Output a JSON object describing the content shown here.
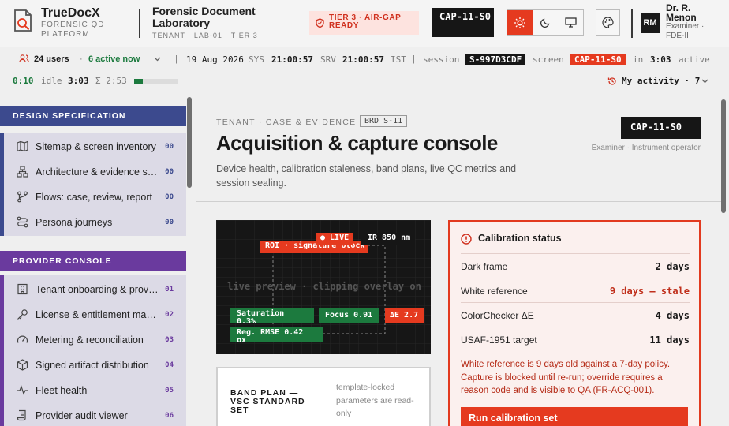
{
  "app": {
    "name": "TrueDocX",
    "subtitle": "FORENSIC QD PLATFORM"
  },
  "lab": {
    "title": "Forensic Document Laboratory",
    "subtitle": "TENANT · LAB-01 · TIER 3"
  },
  "tier_badge": "TIER 3 · AIR-GAP READY",
  "screen_badge": "CAP-11-S0",
  "user": {
    "initials": "RM",
    "name": "Dr. R. Menon",
    "role": "Examiner · FDE-II"
  },
  "status": {
    "users": "24 users",
    "active": "6 active now",
    "date": "19 Aug 2026",
    "sys_label": "SYS",
    "sys_time": "21:00:57",
    "srv_label": "SRV",
    "srv_time": "21:00:57",
    "tz": "IST",
    "session_label": "session",
    "session_id": "S-997D3CDF",
    "screen_label": "screen",
    "screen_id": "CAP-11-S0",
    "in_label": "in",
    "in_time": "3:03",
    "active_label": "active",
    "active_time": "0:10",
    "idle_label": "idle",
    "idle_time": "3:03",
    "sum": "Σ 2:53",
    "activity_progress": 0.2,
    "my_activity": "My activity · 7"
  },
  "sidebar": {
    "sections": [
      {
        "title": "DESIGN SPECIFICATION",
        "color": "#3c4a8e",
        "items": [
          {
            "label": "Sitemap & screen inventory",
            "count": "00",
            "icon": "map-icon"
          },
          {
            "label": "Architecture & evidence services",
            "count": "00",
            "icon": "architecture-icon"
          },
          {
            "label": "Flows: case, review, report",
            "count": "00",
            "icon": "flow-icon"
          },
          {
            "label": "Persona journeys",
            "count": "00",
            "icon": "journey-icon"
          }
        ]
      },
      {
        "title": "PROVIDER CONSOLE",
        "color": "#6a3a9e",
        "items": [
          {
            "label": "Tenant onboarding & provisioning",
            "count": "01",
            "icon": "building-icon"
          },
          {
            "label": "License & entitlement management",
            "count": "02",
            "icon": "key-icon"
          },
          {
            "label": "Metering & reconciliation",
            "count": "03",
            "icon": "gauge-icon"
          },
          {
            "label": "Signed artifact distribution",
            "count": "04",
            "icon": "package-icon"
          },
          {
            "label": "Fleet health",
            "count": "05",
            "icon": "pulse-icon"
          },
          {
            "label": "Provider audit viewer",
            "count": "06",
            "icon": "scroll-icon"
          }
        ]
      }
    ]
  },
  "page": {
    "crumb": "TENANT · CASE & EVIDENCE",
    "brd": "BRD S-11",
    "title": "Acquisition & capture console",
    "description": "Device health, calibration staleness, band plans, live QC metrics and session sealing.",
    "screen_badge": "CAP-11-S0",
    "roles": "Examiner · Instrument operator"
  },
  "preview": {
    "live": "● LIVE",
    "ir": "IR 850 nm",
    "roi": "ROI · signature block",
    "center": "live preview · clipping overlay on",
    "saturation": "Saturation 0.3%",
    "focus": "Focus 0.91",
    "delta_e": "ΔE 2.7",
    "rmse": "Reg. RMSE 0.42 px"
  },
  "band_plan": {
    "title": "BAND PLAN — VSC STANDARD SET",
    "note": "template-locked parameters are read-only"
  },
  "calibration": {
    "title": "Calibration status",
    "rows": [
      {
        "name": "Dark frame",
        "value": "2 days"
      },
      {
        "name": "White reference",
        "value": "9 days — stale"
      },
      {
        "name": "ColorChecker ΔE",
        "value": "4 days"
      },
      {
        "name": "USAF-1951 target",
        "value": "11 days"
      }
    ],
    "note": "White reference is 9 days old against a 7-day policy. Capture is blocked until re-run; override requires a reason code and is visible to QA (FR-ACQ-001).",
    "button": "Run calibration set"
  },
  "colors": {
    "accent": "#e53a1f",
    "success": "#1c7a3e",
    "design": "#3c4a8e",
    "provider": "#6a3a9e"
  }
}
